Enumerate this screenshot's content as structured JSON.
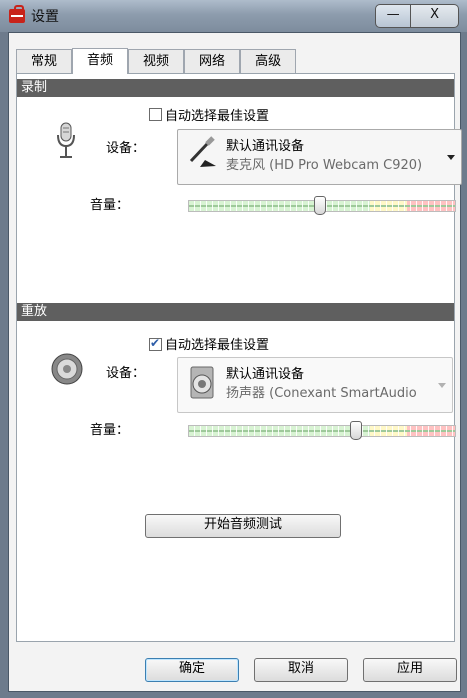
{
  "window": {
    "title": "设置",
    "minimize": "—",
    "close": "X"
  },
  "tabs": [
    "常规",
    "音频",
    "视频",
    "网络",
    "高级"
  ],
  "recording": {
    "header": "录制",
    "auto_label": "自动选择最佳设置",
    "device_label": "设备：",
    "device_name": "默认通讯设备",
    "device_sub": "麦克风 (HD Pro Webcam C920)",
    "volume_label": "音量：",
    "volume_level": 0.49
  },
  "playback": {
    "header": "重放",
    "auto_label": "自动选择最佳设置",
    "device_label": "设备：",
    "device_name": "默认通讯设备",
    "device_sub": "扬声器 (Conexant SmartAudio",
    "volume_label": "音量：",
    "volume_level": 0.63
  },
  "test_button": "开始音频测试",
  "footer": {
    "ok": "确定",
    "cancel": "取消",
    "apply": "应用"
  }
}
